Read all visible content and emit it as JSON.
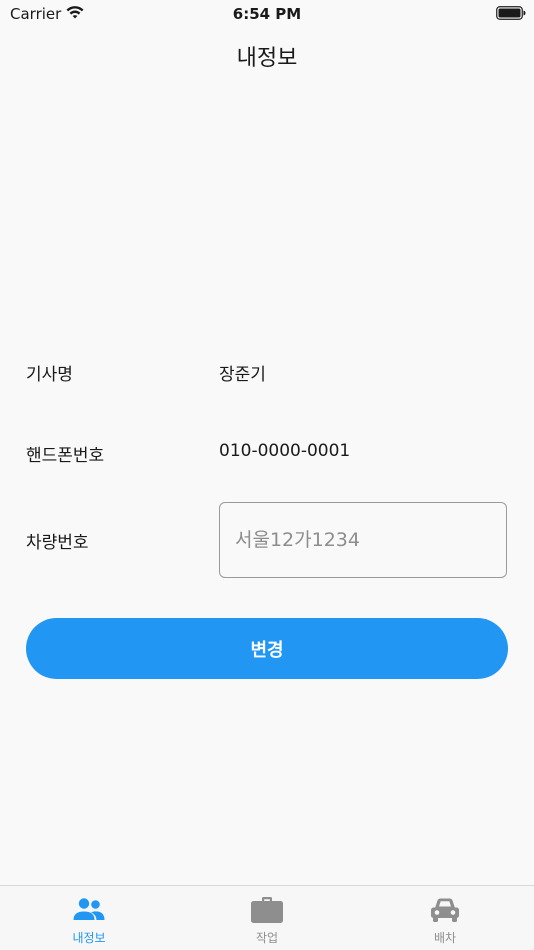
{
  "status_bar": {
    "carrier": "Carrier",
    "time": "6:54 PM"
  },
  "header": {
    "title": "내정보"
  },
  "form": {
    "driver_name_label": "기사명",
    "driver_name_value": "장준기",
    "phone_label": "핸드폰번호",
    "phone_value": "010-0000-0001",
    "plate_label": "차량번호",
    "plate_placeholder": "서울12가1234",
    "plate_value": ""
  },
  "actions": {
    "change_label": "변경"
  },
  "tab_bar": {
    "tabs": [
      {
        "label": "내정보",
        "icon": "people-icon",
        "active": true
      },
      {
        "label": "작업",
        "icon": "briefcase-icon",
        "active": false
      },
      {
        "label": "배차",
        "icon": "car-icon",
        "active": false
      }
    ]
  },
  "colors": {
    "accent": "#2196f3",
    "background": "#f9f9f9",
    "inactive_tab": "#8e8e8e"
  }
}
